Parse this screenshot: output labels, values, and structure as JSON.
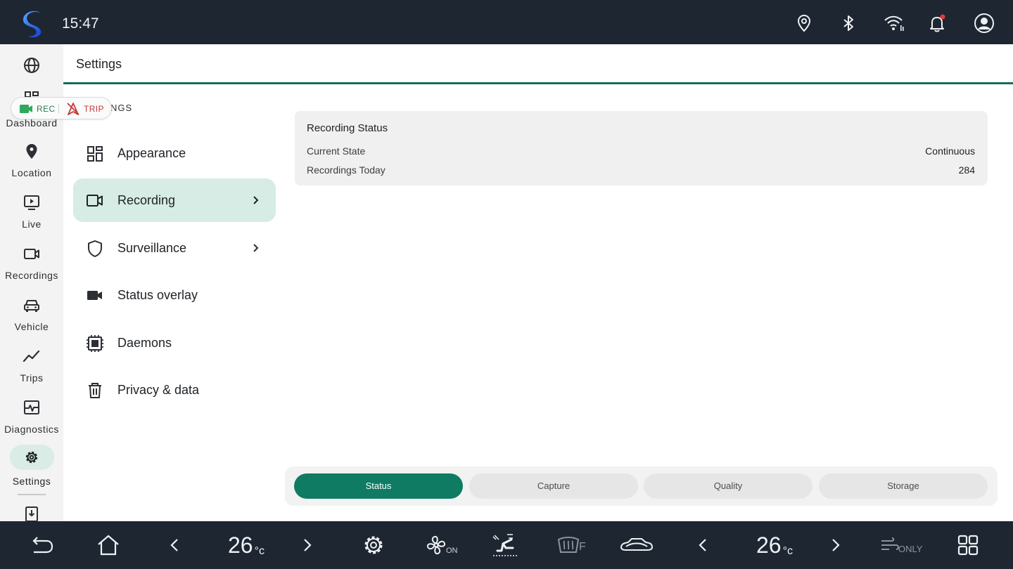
{
  "statusbar": {
    "time": "15:47"
  },
  "nav": {
    "items": [
      {
        "label": "",
        "icon": "globe-icon"
      },
      {
        "label": "Dashboard",
        "icon": "dashboard-icon"
      },
      {
        "label": "Location",
        "icon": "location-pin-icon"
      },
      {
        "label": "Live",
        "icon": "live-play-icon"
      },
      {
        "label": "Recordings",
        "icon": "video-camera-icon"
      },
      {
        "label": "Vehicle",
        "icon": "car-icon"
      },
      {
        "label": "Trips",
        "icon": "trend-line-icon"
      },
      {
        "label": "Diagnostics",
        "icon": "pulse-icon"
      },
      {
        "label": "Settings",
        "icon": "gear-icon"
      }
    ],
    "active": "Settings"
  },
  "chip": {
    "rec_label": "REC",
    "trip_label": "TRIP"
  },
  "main": {
    "title": "Settings",
    "section_header": "NGS"
  },
  "menu": [
    {
      "label": "Appearance",
      "icon": "grid-icon",
      "chevron": false
    },
    {
      "label": "Recording",
      "icon": "video-camera-icon",
      "chevron": true,
      "active": true
    },
    {
      "label": "Surveillance",
      "icon": "shield-icon",
      "chevron": true
    },
    {
      "label": "Status overlay",
      "icon": "video-camera-filled-icon",
      "chevron": false
    },
    {
      "label": "Daemons",
      "icon": "chip-icon",
      "chevron": false
    },
    {
      "label": "Privacy & data",
      "icon": "trash-icon",
      "chevron": false
    }
  ],
  "card": {
    "title": "Recording Status",
    "rows": [
      {
        "label": "Current State",
        "value": "Continuous"
      },
      {
        "label": "Recordings Today",
        "value": "284"
      }
    ]
  },
  "tabs": [
    "Status",
    "Capture",
    "Quality",
    "Storage"
  ],
  "active_tab": "Status",
  "dock": {
    "left_temp": "26",
    "right_temp": "26",
    "temp_unit": "°c",
    "fan_state": "ON",
    "defrost_label": "F",
    "air_label": "ONLY"
  },
  "colors": {
    "bar_bg": "#1e2632",
    "accent": "#0f7b63",
    "active_pill": "#d6ece4",
    "rec_green": "#2e7d4f",
    "trip_red": "#c43a3a",
    "notification_dot": "#e53935"
  }
}
